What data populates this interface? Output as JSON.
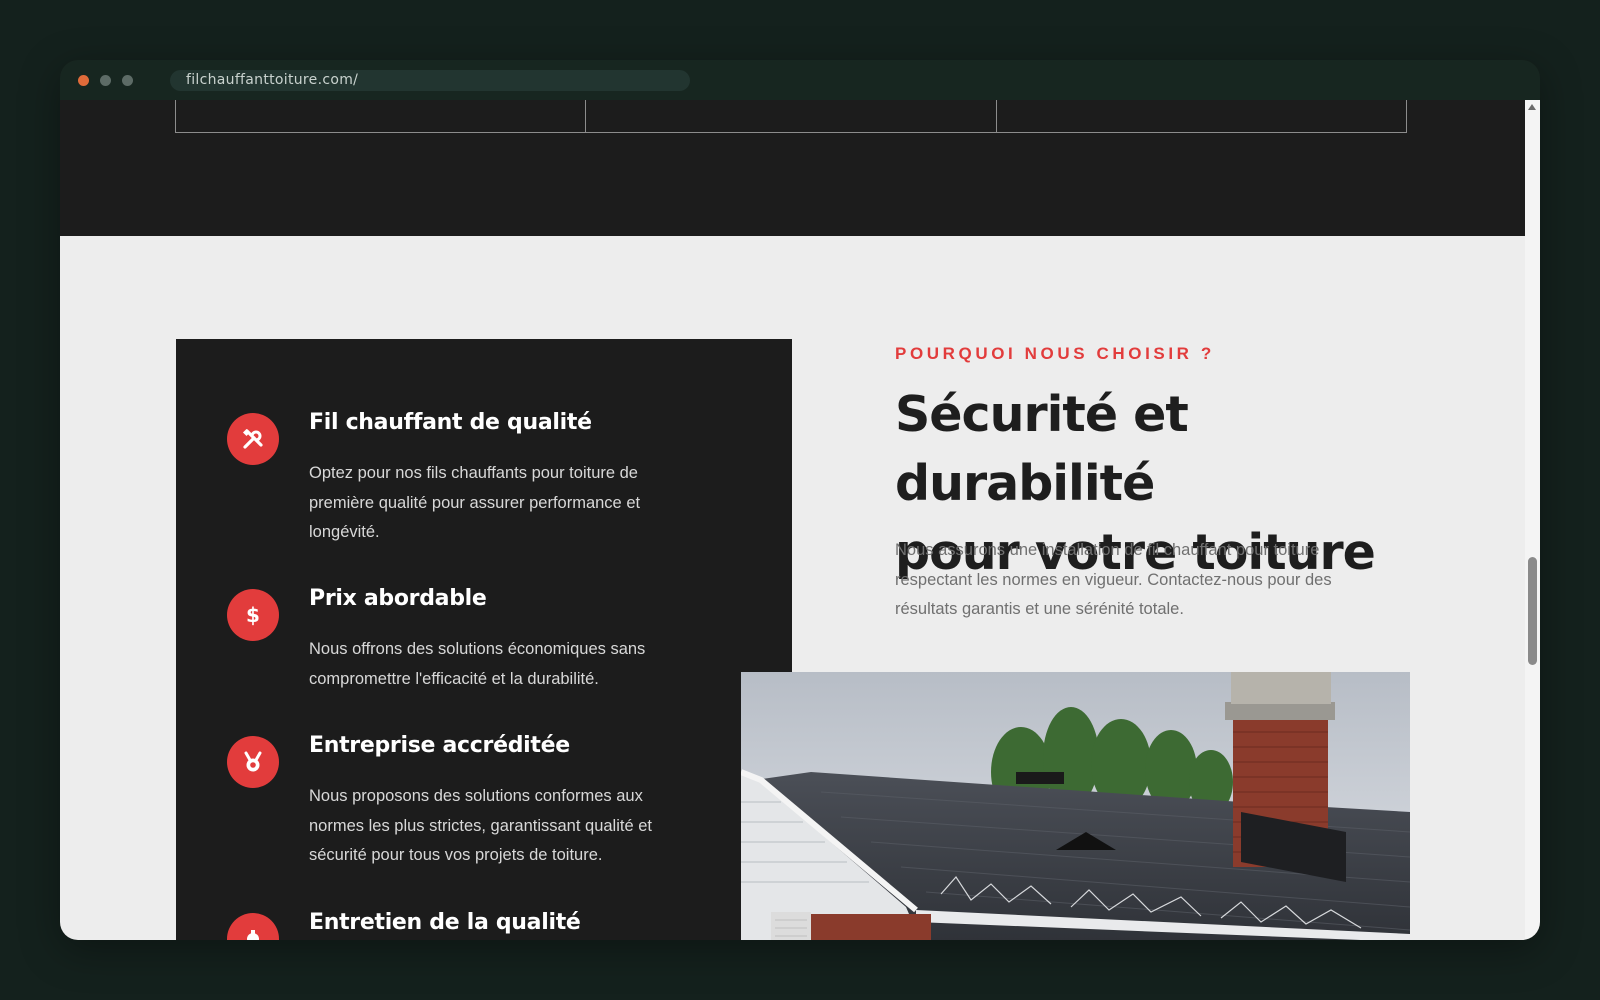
{
  "browser": {
    "url": "filchauffanttoiture.com/"
  },
  "section": {
    "eyebrow": "POURQUOI NOUS CHOISIR ?",
    "heading_line1": "Sécurité et durabilité",
    "heading_line2": "pour votre toiture",
    "lead": "Nous assurons une installation de fil chauffant pour toiture respectant les normes en vigueur. Contactez-nous pour des résultats garantis et une sérénité totale."
  },
  "features": [
    {
      "icon": "tools-icon",
      "title": "Fil chauffant de qualité",
      "description": "Optez pour nos fils chauffants pour toiture de première qualité pour assurer performance et longévité."
    },
    {
      "icon": "dollar-icon",
      "title": "Prix abordable",
      "description": "Nous offrons des solutions économiques sans compromettre l'efficacité et la durabilité."
    },
    {
      "icon": "medal-icon",
      "title": "Entreprise accréditée",
      "description": "Nous proposons des solutions conformes aux normes les plus strictes, garantissant qualité et sécurité pour tous vos projets de toiture."
    },
    {
      "icon": "maintenance-icon",
      "title": "Entretien de la qualité",
      "description": ""
    }
  ],
  "colors": {
    "accent": "#e23c3c",
    "dark_panel": "#1c1c1c",
    "page_bg": "#ededed"
  }
}
